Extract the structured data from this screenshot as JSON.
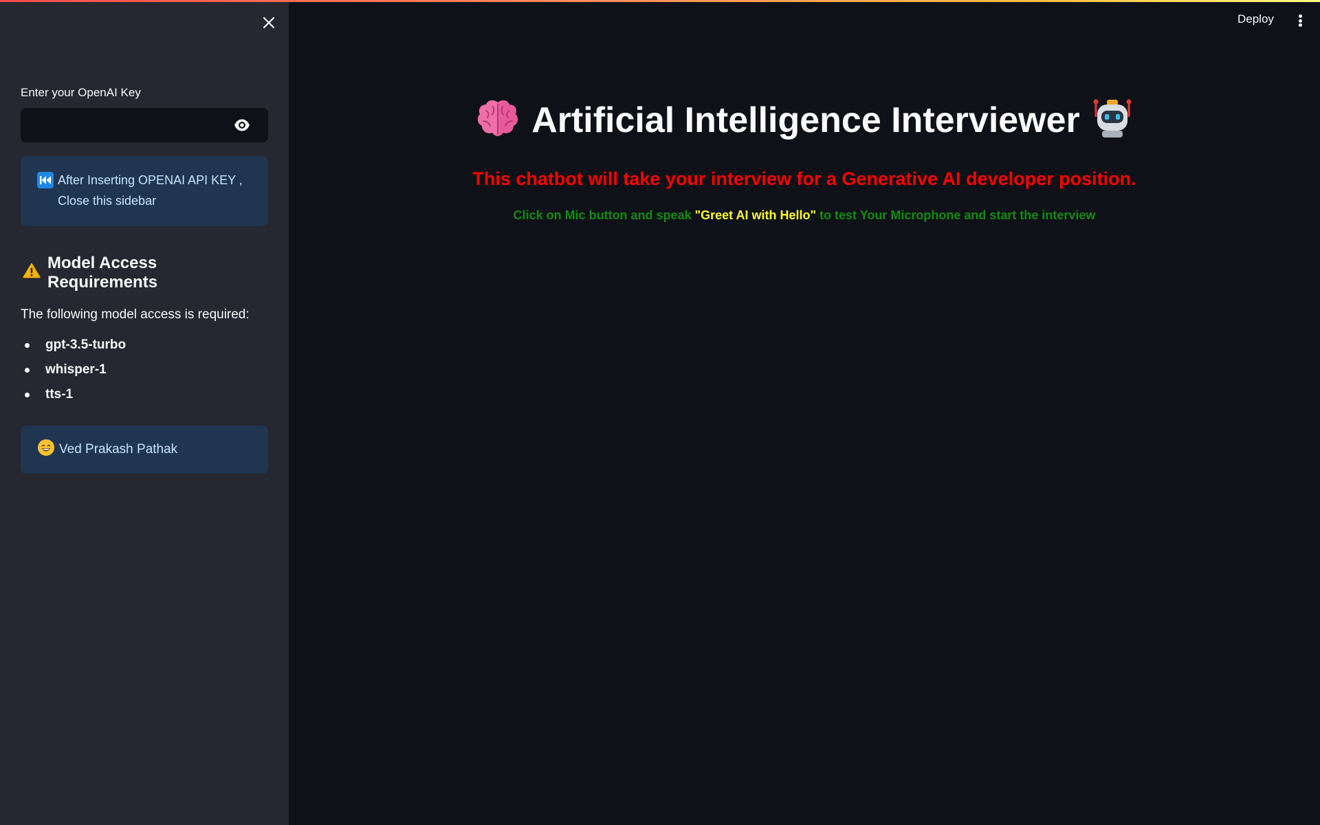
{
  "sidebar": {
    "close_icon": "close-icon",
    "api_key_label": "Enter your OpenAI Key",
    "api_key_value": "",
    "api_key_placeholder": "",
    "eye_icon": "eye-icon",
    "info_icon": "rewind-icon",
    "info_text": "After Inserting OPENAI API KEY , Close this sidebar",
    "requirements_icon": "warning-icon",
    "requirements_heading": "Model Access Requirements",
    "requirements_desc": "The following model access is required:",
    "models": [
      "gpt-3.5-turbo",
      "whisper-1",
      "tts-1"
    ],
    "author_icon": "grinning-face-icon",
    "author_name": "Ved Prakash Pathak"
  },
  "header": {
    "deploy_label": "Deploy",
    "menu_icon": "kebab-menu-icon"
  },
  "main": {
    "title_left_icon": "brain-icon",
    "title": "Artificial Intelligence Interviewer",
    "title_right_icon": "robot-icon",
    "subtitle": "This chatbot will take your interview for a Generative AI developer position.",
    "instruction_prefix": "Click on Mic button and speak ",
    "instruction_highlight": "\"Greet AI with Hello\"",
    "instruction_suffix": " to test Your Microphone and start the interview"
  },
  "colors": {
    "background": "#0e1117",
    "sidebar": "#262730",
    "info_box": "#1f3550",
    "subtitle": "#ff0000",
    "instruction": "#138a13",
    "highlight": "#ffff2e"
  }
}
